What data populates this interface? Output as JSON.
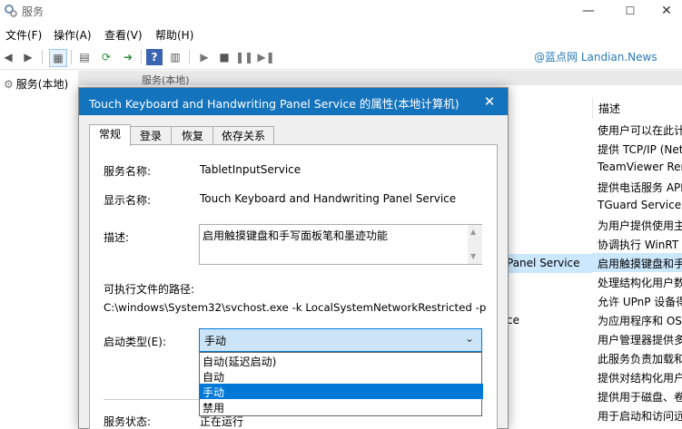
{
  "window": {
    "title": "服务",
    "min_glyph": "—",
    "max_glyph": "☐",
    "close_glyph": "✕"
  },
  "menu": [
    "文件(F)",
    "操作(A)",
    "查看(V)",
    "帮助(H)"
  ],
  "watermark": "@蓝点网 Landian.News",
  "tree": {
    "item_label": "服务(本地)"
  },
  "list": {
    "header_label": "服务(本地)",
    "desc_column": "描述",
    "descriptions": [
      "使用户可以在此计",
      "提供 TCP/IP (Net",
      "TeamViewer Rer",
      "提供电话服务 API",
      "TGuard Service",
      "为用户提供使用主",
      "协调执行 WinRT",
      "启用触摸键盘和手",
      "处理结构化用户数",
      "允许 UPnP 设备得",
      "为应用程序和 OS",
      "用户管理器提供多",
      "此服务负责加载和",
      "提供对结构化用户",
      "提供用于磁盘、卷",
      "用于启动和访问远"
    ],
    "selected_index": 7,
    "name_partial_1": "Panel Service",
    "name_partial_2": "ce"
  },
  "dialog": {
    "title": "Touch Keyboard and Handwriting Panel Service 的属性(本地计算机)",
    "close_glyph": "✕",
    "tabs": [
      "常规",
      "登录",
      "恢复",
      "依存关系"
    ],
    "active_tab": 0,
    "service_name_label": "服务名称:",
    "service_name_value": "TabletInputService",
    "display_name_label": "显示名称:",
    "display_name_value": "Touch Keyboard and Handwriting Panel Service",
    "description_label": "描述:",
    "description_value": "启用触摸键盘和手写面板笔和墨迹功能",
    "exe_path_label": "可执行文件的路径:",
    "exe_path_value": "C:\\windows\\System32\\svchost.exe -k LocalSystemNetworkRestricted -p",
    "startup_type_label": "启动类型(E):",
    "startup_type_value": "手动",
    "startup_options": [
      "自动(延迟启动)",
      "自动",
      "手动",
      "禁用"
    ],
    "highlighted_option": 2,
    "status_label": "服务状态:",
    "status_value": "正在运行"
  }
}
